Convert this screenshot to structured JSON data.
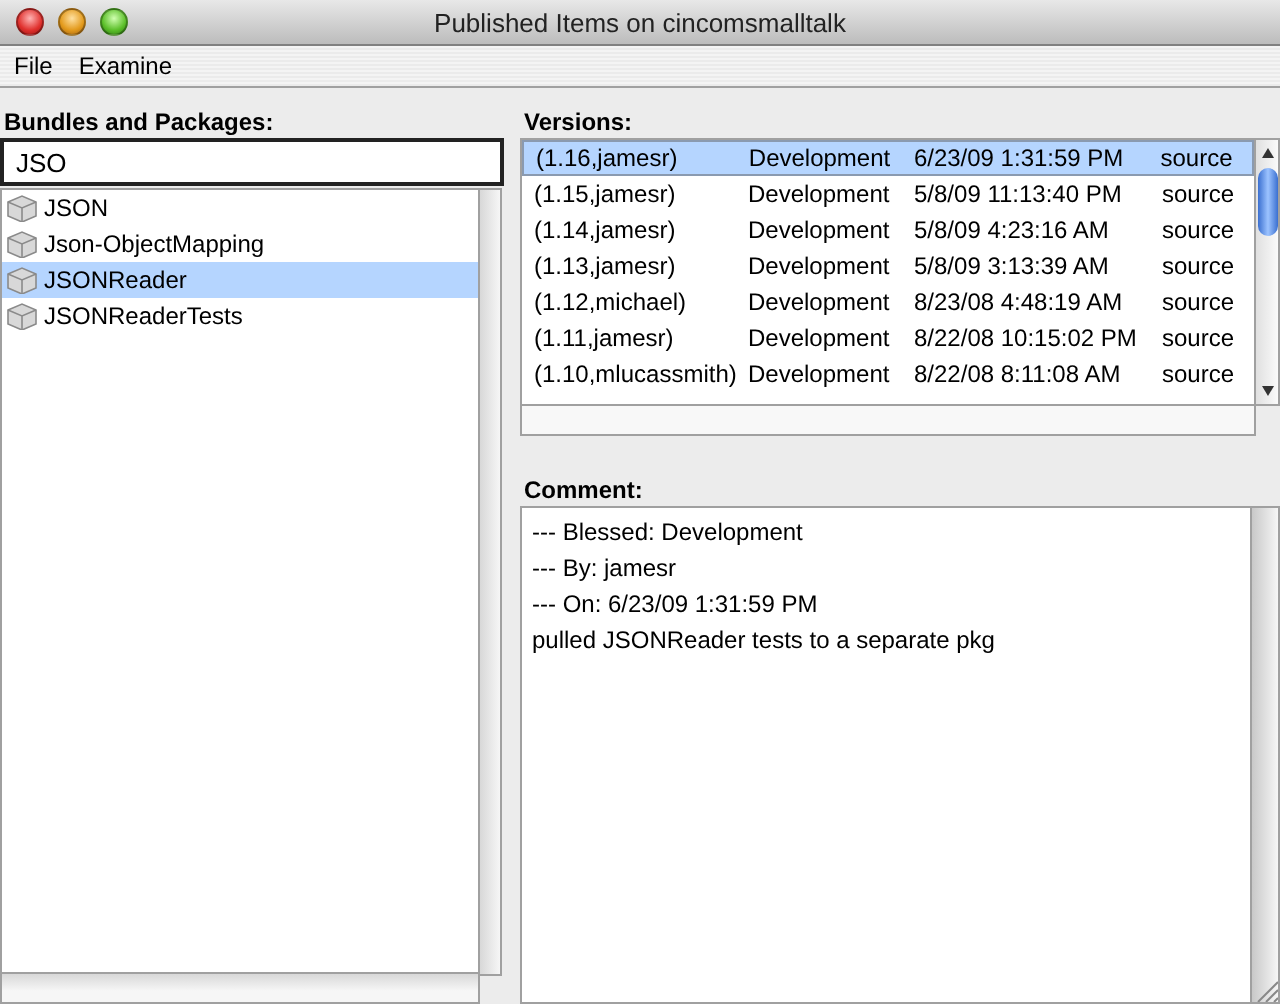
{
  "window": {
    "title": "Published Items on cincomsmalltalk"
  },
  "menu": [
    "File",
    "Examine"
  ],
  "packages": {
    "label": "Bundles and Packages:",
    "filter": "JSO",
    "items": [
      {
        "name": "JSON",
        "selected": false
      },
      {
        "name": "Json-ObjectMapping",
        "selected": false
      },
      {
        "name": "JSONReader",
        "selected": true
      },
      {
        "name": "JSONReaderTests",
        "selected": false
      }
    ]
  },
  "versions": {
    "label": "Versions:",
    "rows": [
      {
        "version": "(1.16,jamesr)",
        "status": "Development",
        "date": "6/23/09 1:31:59 PM",
        "type": "source",
        "selected": true
      },
      {
        "version": "(1.15,jamesr)",
        "status": "Development",
        "date": "5/8/09 11:13:40 PM",
        "type": "source",
        "selected": false
      },
      {
        "version": "(1.14,jamesr)",
        "status": "Development",
        "date": "5/8/09 4:23:16 AM",
        "type": "source",
        "selected": false
      },
      {
        "version": "(1.13,jamesr)",
        "status": "Development",
        "date": "5/8/09 3:13:39 AM",
        "type": "source",
        "selected": false
      },
      {
        "version": "(1.12,michael)",
        "status": "Development",
        "date": "8/23/08 4:48:19 AM",
        "type": "source",
        "selected": false
      },
      {
        "version": "(1.11,jamesr)",
        "status": "Development",
        "date": "8/22/08 10:15:02 PM",
        "type": "source",
        "selected": false
      },
      {
        "version": "(1.10,mlucassmith)",
        "status": "Development",
        "date": "8/22/08 8:11:08 AM",
        "type": "source",
        "selected": false
      }
    ]
  },
  "comment": {
    "label": "Comment:",
    "lines": [
      "--- Blessed: Development",
      "--- By: jamesr",
      "--- On: 6/23/09 1:31:59 PM",
      "pulled JSONReader tests to a separate pkg"
    ]
  }
}
